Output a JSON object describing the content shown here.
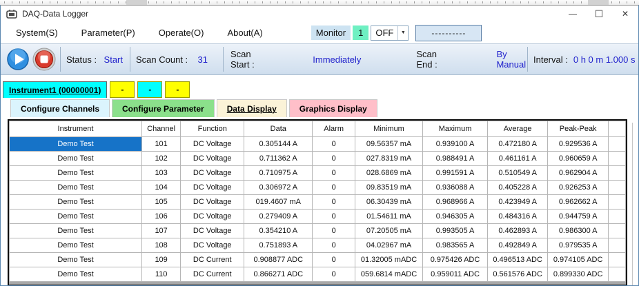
{
  "window": {
    "title": "DAQ-Data Logger",
    "minimize_glyph": "—",
    "maximize_glyph": "☐",
    "close_glyph": "✕"
  },
  "menu": {
    "items": [
      "System(S)",
      "Parameter(P)",
      "Operate(O)",
      "About(A)"
    ],
    "monitor": {
      "label": "Monitor",
      "count": "1",
      "state": "OFF",
      "dropdown_glyph": "▼",
      "dash_button_label": "----------"
    }
  },
  "toolbar": {
    "fields": [
      {
        "label": "Status :",
        "value": "Start"
      },
      {
        "label": "Scan Count :",
        "value": "31"
      },
      {
        "label": "Scan Start :",
        "value": "Immediately"
      },
      {
        "label": "Scan End :",
        "value": "By Manual"
      },
      {
        "label": "Interval :",
        "value": "0 h 0 m 1.000 s"
      }
    ]
  },
  "instrument_tabs": [
    {
      "label": "Instrument1 (00000001)",
      "color": "#00ffff",
      "active": true
    },
    {
      "label": "-",
      "color": "#ffff00",
      "active": false
    },
    {
      "label": "-",
      "color": "#00ffff",
      "active": false
    },
    {
      "label": "-",
      "color": "#ffff00",
      "active": false
    }
  ],
  "view_tabs": [
    {
      "label": "Configure Channels",
      "color": "#dbf4fd",
      "active": false
    },
    {
      "label": "Configure Parameter",
      "color": "#8be08b",
      "active": false
    },
    {
      "label": "Data Display",
      "color": "#fbf3d8",
      "active": true
    },
    {
      "label": "Graphics Display",
      "color": "#ffbfc9",
      "active": false
    }
  ],
  "table": {
    "columns": [
      "Instrument",
      "Channel",
      "Function",
      "Data",
      "Alarm",
      "Minimum",
      "Maximum",
      "Average",
      "Peak-Peak"
    ],
    "rows": [
      [
        "Demo Test",
        "101",
        "DC Voltage",
        "0.305144 A",
        "0",
        "09.56357 mA",
        "0.939100 A",
        "0.472180 A",
        "0.929536 A"
      ],
      [
        "Demo Test",
        "102",
        "DC Voltage",
        "0.711362 A",
        "0",
        "027.8319 mA",
        "0.988491 A",
        "0.461161 A",
        "0.960659 A"
      ],
      [
        "Demo Test",
        "103",
        "DC Voltage",
        "0.710975 A",
        "0",
        "028.6869 mA",
        "0.991591 A",
        "0.510549 A",
        "0.962904 A"
      ],
      [
        "Demo Test",
        "104",
        "DC Voltage",
        "0.306972 A",
        "0",
        "09.83519 mA",
        "0.936088 A",
        "0.405228 A",
        "0.926253 A"
      ],
      [
        "Demo Test",
        "105",
        "DC Voltage",
        "019.4607 mA",
        "0",
        "06.30439 mA",
        "0.968966 A",
        "0.423949 A",
        "0.962662 A"
      ],
      [
        "Demo Test",
        "106",
        "DC Voltage",
        "0.279409 A",
        "0",
        "01.54611 mA",
        "0.946305 A",
        "0.484316 A",
        "0.944759 A"
      ],
      [
        "Demo Test",
        "107",
        "DC Voltage",
        "0.354210 A",
        "0",
        "07.20505 mA",
        "0.993505 A",
        "0.462893 A",
        "0.986300 A"
      ],
      [
        "Demo Test",
        "108",
        "DC Voltage",
        "0.751893 A",
        "0",
        "04.02967 mA",
        "0.983565 A",
        "0.492849 A",
        "0.979535 A"
      ],
      [
        "Demo Test",
        "109",
        "DC Current",
        "0.908877 ADC",
        "0",
        "01.32005 mADC",
        "0.975426 ADC",
        "0.496513 ADC",
        "0.974105 ADC"
      ],
      [
        "Demo Test",
        "110",
        "DC Current",
        "0.866271 ADC",
        "0",
        "059.6814 mADC",
        "0.959011 ADC",
        "0.561576 ADC",
        "0.899330 ADC"
      ]
    ],
    "selected_cell": {
      "row": 0,
      "col": 0
    }
  },
  "colors": {
    "value_text": "#2021cc",
    "selected_cell_bg": "#1673c8",
    "monitor_label_bg": "#cde3f2",
    "monitor_count_bg": "#6ef0c2",
    "toolbar_bg_top": "#ecf2f9",
    "toolbar_bg_bottom": "#cfdeee",
    "table_filler": "#a9a9a9"
  }
}
